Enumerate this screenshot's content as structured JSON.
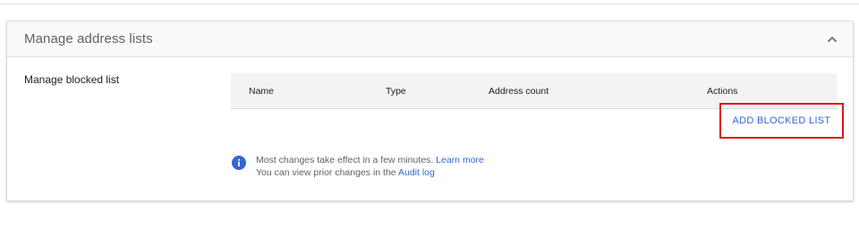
{
  "panel": {
    "title": "Manage address lists",
    "collapse_icon": "chevron-up-icon"
  },
  "blocked_list": {
    "label": "Manage blocked list",
    "columns": [
      "Name",
      "Type",
      "Address count",
      "Actions"
    ],
    "add_button_label": "ADD BLOCKED LIST"
  },
  "info": {
    "icon": "info-icon",
    "line1_text": "Most changes take effect in a few minutes.",
    "learn_more_link": "Learn more",
    "line2_text": "You can view prior changes in the",
    "audit_log_link": "Audit log"
  },
  "colors": {
    "link": "#3367d6",
    "highlight_border": "#e0141a",
    "info_icon": "#3367d6"
  }
}
